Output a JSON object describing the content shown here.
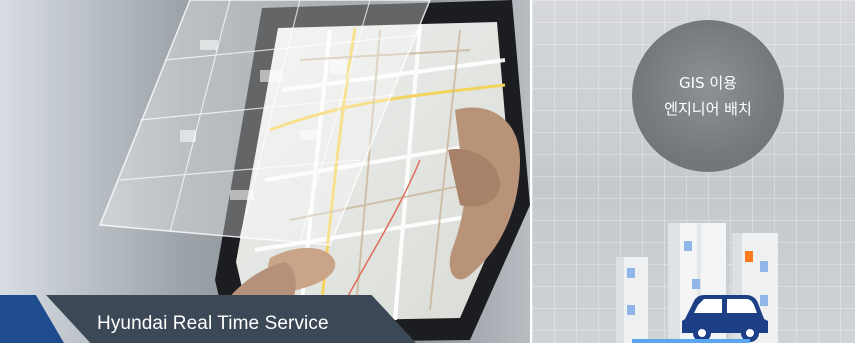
{
  "caption": {
    "text": "Hyundai Real Time Service"
  },
  "gis_bubble": {
    "line1": "GIS 이용",
    "line2": "엔지니어 배치"
  },
  "icons": {
    "tablet": "tablet-map-icon",
    "building": "building-icon",
    "car": "car-icon"
  },
  "colors": {
    "caption_bar": "#3c4856",
    "accent_blue": "#1f4c8f",
    "car_blue": "#1c3f86",
    "window_orange": "#ff7a1a",
    "bubble": "#75797d"
  }
}
